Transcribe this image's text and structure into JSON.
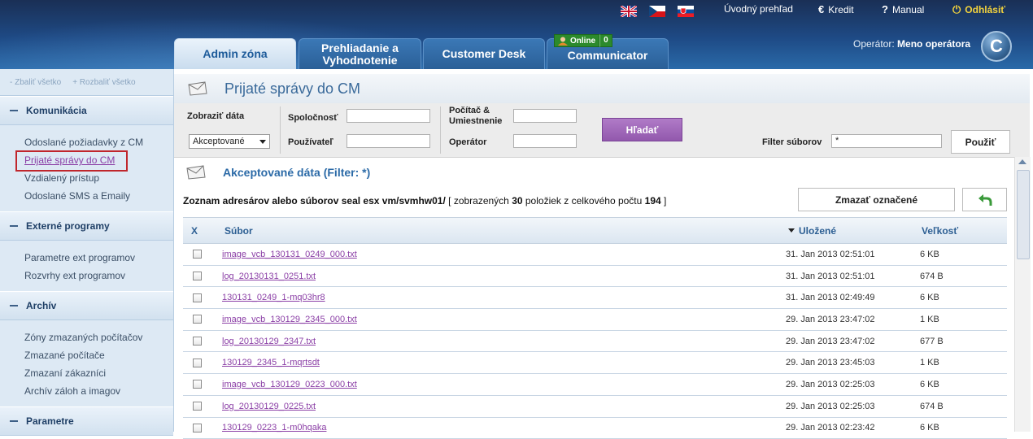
{
  "header": {
    "flags": [
      "UK flag",
      "Czech flag",
      "Slovak flag"
    ],
    "overview_label": "Úvodný prehľad",
    "credit_label": "Kredit",
    "manual_label": "Manual",
    "logout_label": "Odhlásiť",
    "tabs": [
      "Admin zóna",
      "Prehliadanie a Vyhodnotenie",
      "Customer Desk",
      "Communicator"
    ],
    "tab2_line1": "Prehliadanie a",
    "tab2_line2": "Vyhodnotenie",
    "online_label": "Online",
    "online_count": "0",
    "operator_prefix": "Operátor:",
    "operator_name": "Meno operátora",
    "logo_letter": "C"
  },
  "sidebar": {
    "collapse_all": "- Zbaliť všetko",
    "expand_all": "+ Rozbaliť všetko",
    "sections": [
      {
        "title": "Komunikácia",
        "items": [
          "Odoslané požiadavky z CM",
          "Prijaté správy do CM",
          "Vzdialený prístup",
          "Odoslané SMS a Emaily"
        ]
      },
      {
        "title": "Externé programy",
        "items": [
          "Parametre ext programov",
          "Rozvrhy ext programov"
        ]
      },
      {
        "title": "Archív",
        "items": [
          "Zóny zmazaných počítačov",
          "Zmazané počítače",
          "Zmazaní zákazníci",
          "Archív záloh a imagov"
        ]
      },
      {
        "title": "Parametre",
        "items": []
      }
    ]
  },
  "page": {
    "title": "Prijaté správy do CM",
    "filters": {
      "show_data_label": "Zobraziť dáta",
      "show_data_value": "Akceptované",
      "company_label": "Spoločnosť",
      "user_label": "Používateľ",
      "computer_label_1": "Počítač &",
      "computer_label_2": "Umiestnenie",
      "operator_label": "Operátor",
      "search_button": "Hľadať",
      "file_filter_label": "Filter súborov",
      "file_filter_value": "*",
      "apply_button": "Použiť"
    },
    "section_title": "Akceptované dáta (Filter: *)",
    "dir_prefix": "Zoznam adresárov alebo súborov seal esx vm/svmhw01/",
    "dir_mid": " [ zobrazených ",
    "dir_shown": "30",
    "dir_mid2": " položiek z celkového počtu ",
    "dir_total": "194",
    "dir_suffix": " ]",
    "delete_button": "Zmazať označené",
    "back_icon": "back-arrow-icon"
  },
  "table": {
    "columns": {
      "x": "X",
      "file": "Súbor",
      "saved": "Uložené",
      "size": "Veľkosť"
    },
    "rows": [
      {
        "file": "image_vcb_130131_0249_000.txt",
        "saved": "31. Jan 2013 02:51:01",
        "size": "6 KB"
      },
      {
        "file": "log_20130131_0251.txt",
        "saved": "31. Jan 2013 02:51:01",
        "size": "674 B"
      },
      {
        "file": "130131_0249_1-mq03hr8",
        "saved": "31. Jan 2013 02:49:49",
        "size": "6 KB"
      },
      {
        "file": "image_vcb_130129_2345_000.txt",
        "saved": "29. Jan 2013 23:47:02",
        "size": "1 KB"
      },
      {
        "file": "log_20130129_2347.txt",
        "saved": "29. Jan 2013 23:47:02",
        "size": "677 B"
      },
      {
        "file": "130129_2345_1-mqrtsdt",
        "saved": "29. Jan 2013 23:45:03",
        "size": "1 KB"
      },
      {
        "file": "image_vcb_130129_0223_000.txt",
        "saved": "29. Jan 2013 02:25:03",
        "size": "6 KB"
      },
      {
        "file": "log_20130129_0225.txt",
        "saved": "29. Jan 2013 02:25:03",
        "size": "674 B"
      },
      {
        "file": "130129_0223_1-m0hqaka",
        "saved": "29. Jan 2013 02:23:42",
        "size": "6 KB"
      }
    ]
  }
}
